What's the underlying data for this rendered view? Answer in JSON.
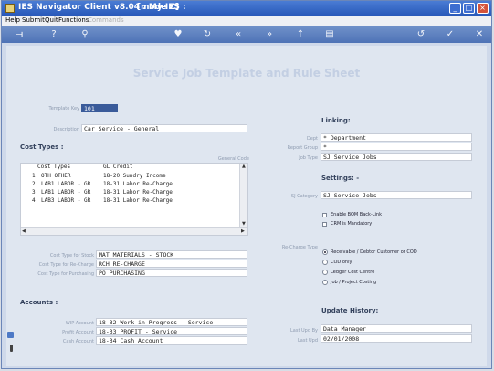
{
  "window": {
    "title": "IES Navigator Client v8.04 : My IES :",
    "mode": "[mode Z]"
  },
  "menu": {
    "help": "Help",
    "submit": "Submit",
    "quit": "Quit",
    "functions": "Functions",
    "commands": "Commands"
  },
  "toolbar_icons": [
    "exit-icon",
    "help-icon",
    "search-icon",
    "favorite-icon",
    "refresh-icon",
    "first-icon",
    "previous-icon",
    "next-icon",
    "last-icon",
    "new-icon",
    "save-icon",
    "delete-icon",
    "ok-icon",
    "cancel-icon"
  ],
  "form": {
    "heading": "Service Job Template and Rule Sheet",
    "template_key_label": "Template Key",
    "template_key": "101",
    "description_label": "Description",
    "description": "Car Service - General",
    "cost_types_heading": "Cost Types :",
    "general_code_label": "General Code",
    "cost_grid": {
      "headers": {
        "cost_types": "Cost Types",
        "gl_credit": "GL Credit"
      },
      "rows": [
        {
          "num": "1",
          "type": "OTH OTHER",
          "gl": "18-20 Sundry Income"
        },
        {
          "num": "2",
          "type": "LAB1 LABOR - GR",
          "gl": "18-31 Labor Re-Charge"
        },
        {
          "num": "3",
          "type": "LAB1 LABOR - GR",
          "gl": "18-31 Labor Re-Charge"
        },
        {
          "num": "4",
          "type": "LAB3 LABOR - GR",
          "gl": "18-31 Labor Re-Charge"
        }
      ]
    },
    "cost_type_stock_label": "Cost Type for Stock",
    "cost_type_stock": "MAT MATERIALS - STOCK",
    "cost_type_recharge_label": "Cost Type for Re-Charge",
    "cost_type_recharge": "RCH RE-CHARGE",
    "cost_type_purchasing_label": "Cost Type for Purchasing",
    "cost_type_purchasing": "PO PURCHASING",
    "accounts_heading": "Accounts :",
    "wip_account_label": "WIP Account",
    "wip_account": "18-32 Work in Progress - Service",
    "profit_account_label": "Profit Account",
    "profit_account": "18-33 PROFIT - Service",
    "cash_account_label": "Cash Account",
    "cash_account": "18-34 Cash Account",
    "linking_heading": "Linking:",
    "dept_label": "Dept",
    "dept": "* Department",
    "report_group_label": "Report Group",
    "report_group": "*",
    "job_type_label": "Job Type",
    "job_type": "SJ Service Jobs",
    "settings_heading": "Settings: -",
    "sj_category_label": "SJ Category",
    "sj_category": "SJ Service Jobs",
    "enable_bom_label": "Enable BOM Back-Link",
    "crm_mandatory_label": "CRM is Mandatory",
    "recharge_type_label": "Re-Charge Type",
    "recharge_options": [
      {
        "label": "Receivable / Debtor Customer or COD",
        "selected": true
      },
      {
        "label": "COD only",
        "selected": false
      },
      {
        "label": "Ledger Cost Centre",
        "selected": false
      },
      {
        "label": "Job / Project Costing",
        "selected": false
      }
    ],
    "update_history_heading": "Update History:",
    "last_upd_by_label": "Last Upd By",
    "last_upd_by": "Data Manager",
    "last_upd_label": "Last Upd",
    "last_upd": "02/01/2008"
  }
}
